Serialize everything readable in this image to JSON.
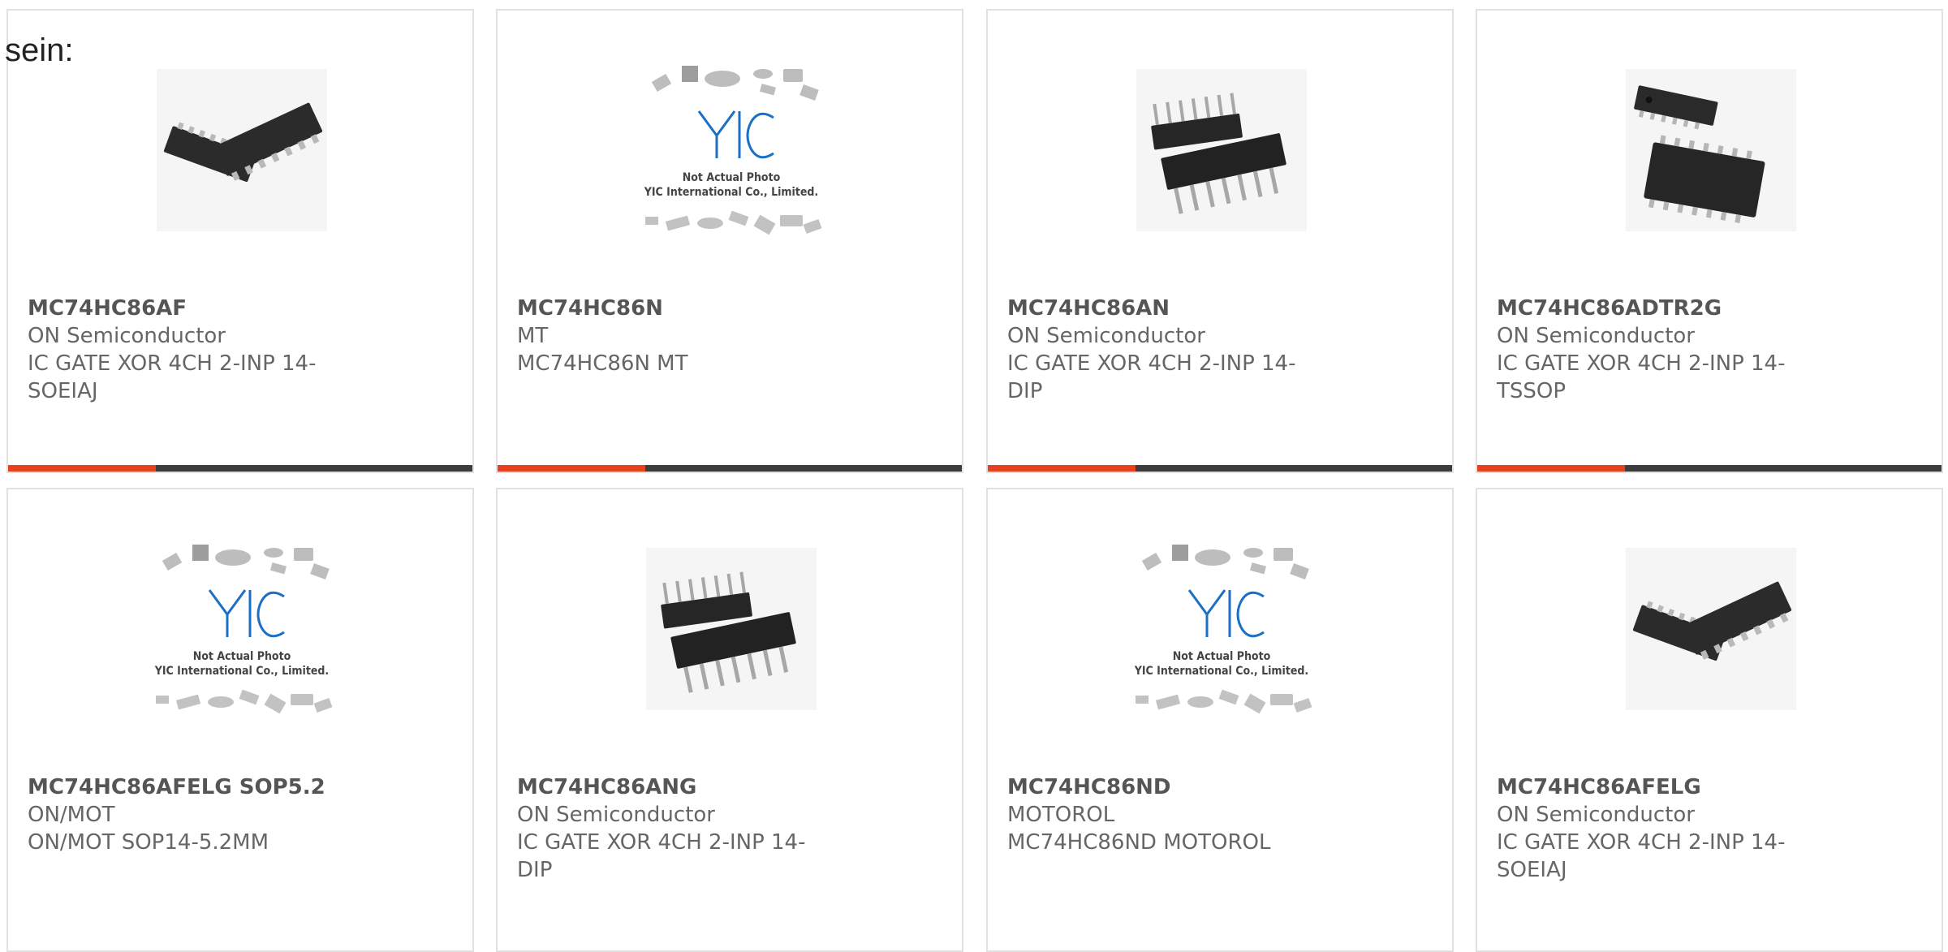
{
  "intro_text": "sein:",
  "colors": {
    "accent": "#e8401c",
    "bar_dark": "#3c3c3c",
    "card_border": "#e1e1e1",
    "brand_blue": "#1b6fc4"
  },
  "placeholder": {
    "line1": "Not Actual Photo",
    "line2": "YIC International Co., Limited."
  },
  "products": [
    {
      "part": "MC74HC86AF",
      "manufacturer": "ON Semiconductor",
      "description": "IC GATE XOR 4CH 2-INP 14-SOEIAJ",
      "image": "soic-chip-icon"
    },
    {
      "part": "MC74HC86N",
      "manufacturer": "MT",
      "description": "MC74HC86N MT",
      "image": "placeholder"
    },
    {
      "part": "MC74HC86AN",
      "manufacturer": "ON Semiconductor",
      "description": "IC GATE XOR 4CH 2-INP 14-DIP",
      "image": "dip-chip-icon"
    },
    {
      "part": "MC74HC86ADTR2G",
      "manufacturer": "ON Semiconductor",
      "description": "IC GATE XOR 4CH 2-INP 14-TSSOP",
      "image": "tssop-chip-icon"
    },
    {
      "part": "MC74HC86AFELG SOP5.2",
      "manufacturer": "ON/MOT",
      "description": "ON/MOT SOP14-5.2MM",
      "image": "placeholder"
    },
    {
      "part": "MC74HC86ANG",
      "manufacturer": "ON Semiconductor",
      "description": "IC GATE XOR 4CH 2-INP 14-DIP",
      "image": "dip-chip-icon"
    },
    {
      "part": "MC74HC86ND",
      "manufacturer": "MOTOROL",
      "description": "MC74HC86ND MOTOROL",
      "image": "placeholder"
    },
    {
      "part": "MC74HC86AFELG",
      "manufacturer": "ON Semiconductor",
      "description": "IC GATE XOR 4CH 2-INP 14-SOEIAJ",
      "image": "soic-chip-icon"
    }
  ]
}
